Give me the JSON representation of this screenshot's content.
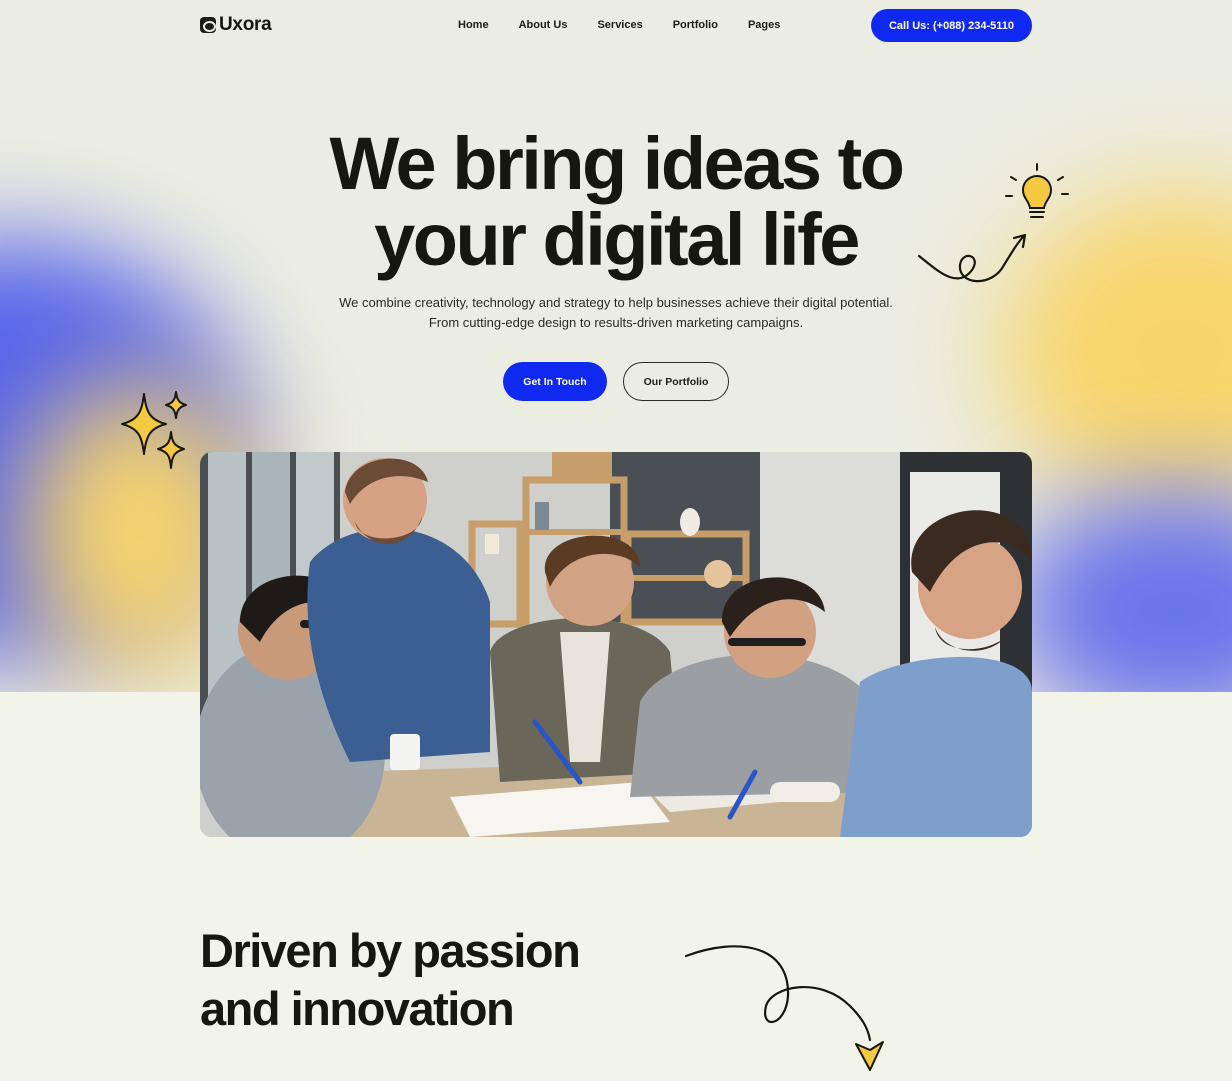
{
  "brand": {
    "name": "Uxora",
    "logo_icon": "uxora-logo-icon"
  },
  "nav": {
    "items": [
      {
        "label": "Home"
      },
      {
        "label": "About Us"
      },
      {
        "label": "Services"
      },
      {
        "label": "Portfolio"
      },
      {
        "label": "Pages"
      }
    ],
    "call_label": "Call Us: (+088) 234-5110"
  },
  "hero": {
    "headline_line1": "We bring ideas to",
    "headline_line2": "your digital life",
    "sub_line1": "We combine creativity, technology and strategy to help businesses achieve their digital potential.",
    "sub_line2": "From cutting-edge design to results-driven marketing campaigns.",
    "primary_cta": "Get In Touch",
    "secondary_cta": "Our Portfolio"
  },
  "section": {
    "title_line1": "Driven by passion",
    "title_line2": "and innovation"
  },
  "colors": {
    "accent": "#1029f0",
    "background": "#f3f4e9",
    "text": "#16170f",
    "doodle_yellow": "#f5c842"
  }
}
